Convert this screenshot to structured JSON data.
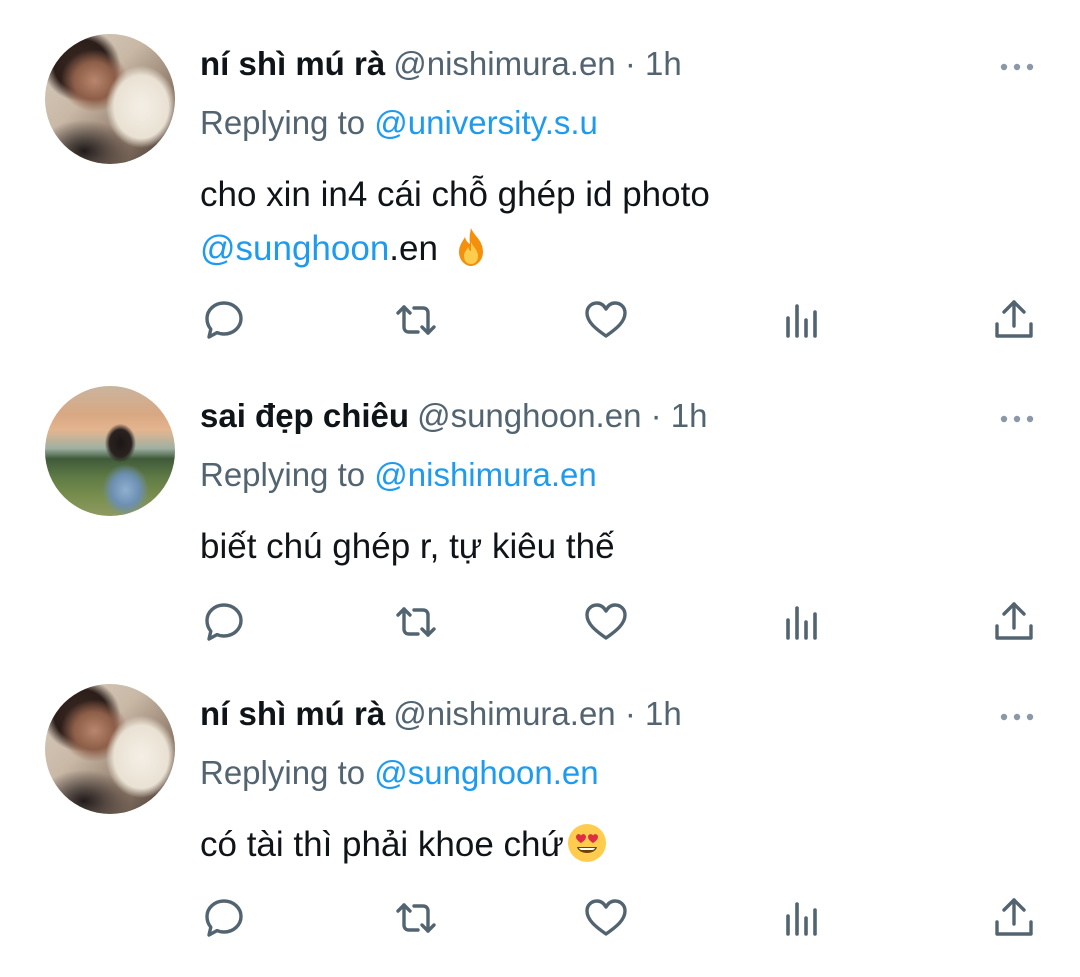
{
  "tweets": [
    {
      "display_name": "ní shì mú rà",
      "handle": "@nishimura.en",
      "time": "· 1h",
      "replying_prefix": "Replying to ",
      "replying_to": "@university.s.u",
      "line1": "cho xin in4 cái chỗ ghép id photo",
      "mention": "@sunghoon",
      "after_mention": ".en",
      "emoji": "fire-emoji"
    },
    {
      "display_name": "sai đẹp chiêu",
      "handle": "@sunghoon.en",
      "time": "· 1h",
      "replying_prefix": "Replying to ",
      "replying_to": "@nishimura.en",
      "text": "biết chú ghép r, tự kiêu thế"
    },
    {
      "display_name": "ní shì mú rà",
      "handle": "@nishimura.en",
      "time": "· 1h",
      "replying_prefix": "Replying to ",
      "replying_to": "@sunghoon.en",
      "text": "có tài thì phải khoe chứ",
      "emoji": "heart-eyes-emoji"
    }
  ],
  "icons": {
    "more": "more-icon",
    "reply": "reply-icon",
    "retweet": "retweet-icon",
    "like": "like-icon",
    "views": "views-icon",
    "share": "share-icon"
  },
  "colors": {
    "link": "#1d9bf0",
    "secondary_text": "#536471",
    "primary_text": "#0f1419",
    "icon": "#536471"
  }
}
